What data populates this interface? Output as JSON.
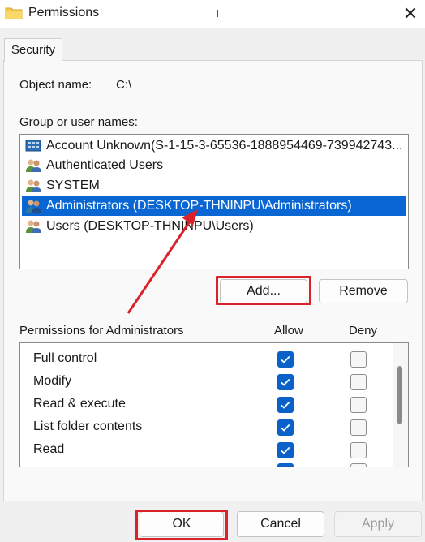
{
  "window": {
    "title": "Permissions"
  },
  "tabs": [
    {
      "label": "Security"
    }
  ],
  "object": {
    "label": "Object name:",
    "value": "C:\\"
  },
  "group_label": "Group or user names:",
  "users": [
    {
      "name": "Account Unknown(S-1-15-3-65536-1888954469-739942743...",
      "icon": "unknown-account-icon",
      "selected": false
    },
    {
      "name": "Authenticated Users",
      "icon": "user-group-icon",
      "selected": false
    },
    {
      "name": "SYSTEM",
      "icon": "user-group-icon",
      "selected": false
    },
    {
      "name": "Administrators (DESKTOP-THNINPU\\Administrators)",
      "icon": "user-group-icon",
      "selected": true
    },
    {
      "name": "Users (DESKTOP-THNINPU\\Users)",
      "icon": "user-group-icon",
      "selected": false
    }
  ],
  "buttons": {
    "add": "Add...",
    "remove": "Remove",
    "ok": "OK",
    "cancel": "Cancel",
    "apply": "Apply"
  },
  "permissions_header": {
    "title": "Permissions for Administrators",
    "allow": "Allow",
    "deny": "Deny"
  },
  "permissions": [
    {
      "name": "Full control",
      "allow": true,
      "deny": false
    },
    {
      "name": "Modify",
      "allow": true,
      "deny": false
    },
    {
      "name": "Read & execute",
      "allow": true,
      "deny": false
    },
    {
      "name": "List folder contents",
      "allow": true,
      "deny": false
    },
    {
      "name": "Read",
      "allow": true,
      "deny": false
    }
  ],
  "colors": {
    "selection": "#0a66d2",
    "checkbox_checked": "#0a62c9",
    "annotation": "#d9222a",
    "folder": "#f2c94c"
  }
}
